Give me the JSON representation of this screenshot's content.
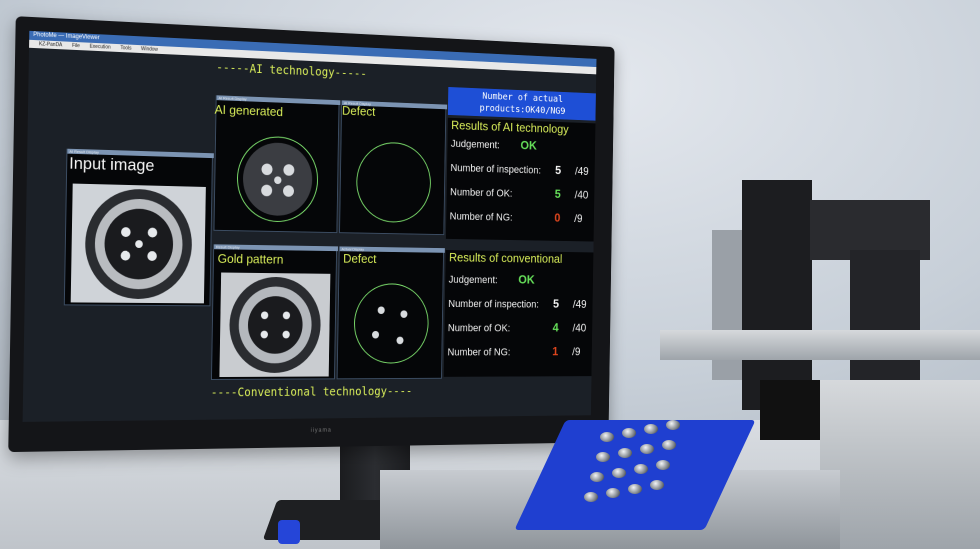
{
  "window": {
    "titlebar": "PhotoMe — ImageViewer",
    "app_title": "KZ-PanDA",
    "menu": [
      "File",
      "Execution",
      "Tools",
      "Window"
    ]
  },
  "ai_section": {
    "heading": "-----AI technology-----",
    "ai_generated_label": "AI generated",
    "defect_label": "Defect",
    "pane_ai_generated": "AI Result Display",
    "pane_defect": "AI Result Display"
  },
  "input_section": {
    "label": "Input image",
    "pane_title": "AI Result Display"
  },
  "actual_box": {
    "line1": "Number of actual",
    "line2": "products:OK40/NG9"
  },
  "ai_results": {
    "heading": "Results of AI technology",
    "judgement_label": "Judgement:",
    "judgement_value": "OK",
    "inspection_label": "Number of inspection:",
    "inspection_value": "5",
    "inspection_total": "/49",
    "ok_label": "Number of OK:",
    "ok_value": "5",
    "ok_total": "/40",
    "ng_label": "Number of NG:",
    "ng_value": "0",
    "ng_total": "/9"
  },
  "conv_section": {
    "heading": "----Conventional technology----",
    "gold_label": "Gold pattern",
    "defect_label": "Defect",
    "pane_gold": "Result Display",
    "pane_defect": "Actual Display"
  },
  "conv_results": {
    "heading": "Results of conventional",
    "judgement_label": "Judgement:",
    "judgement_value": "OK",
    "inspection_label": "Number of inspection:",
    "inspection_value": "5",
    "inspection_total": "/49",
    "ok_label": "Number of OK:",
    "ok_value": "4",
    "ok_total": "/40",
    "ng_label": "Number of NG:",
    "ng_value": "1",
    "ng_total": "/9"
  },
  "monitor_brand": "iiyama",
  "colors": {
    "label_yellow": "#d9ee5a",
    "ok_green": "#66e05a",
    "ng_red": "#e0461e",
    "actual_box_blue": "#1e4fd6",
    "tray_blue": "#1f3fd0"
  },
  "icons": [
    "connector-image",
    "defect-circle",
    "camera-rig"
  ]
}
